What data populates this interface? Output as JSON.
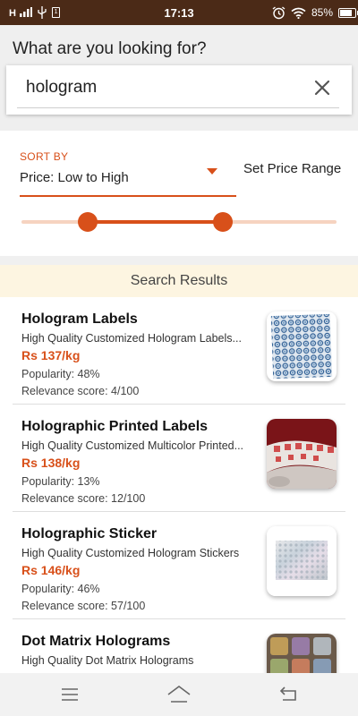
{
  "status_bar": {
    "signal_text": "H",
    "time": "17:13",
    "battery_percent": "85%",
    "battery_level": 0.85,
    "icons": [
      "signal-icon",
      "usb-icon",
      "sim-icon",
      "alarm-icon",
      "wifi-icon",
      "battery-icon",
      "charging-icon"
    ]
  },
  "search": {
    "heading": "What are you looking for?",
    "query": "hologram",
    "clear_icon": "close-icon"
  },
  "filters": {
    "sort_label": "SORT BY",
    "sort_value": "Price: Low to High",
    "price_range_label": "Set Price Range",
    "range_low": 0.21,
    "range_high": 0.64,
    "accent_color": "#d8501a"
  },
  "results": {
    "header": "Search Results",
    "items": [
      {
        "title": "Hologram Labels",
        "description": "High Quality Customized Hologram Labels...",
        "price": "Rs 137/kg",
        "popularity": "Popularity: 48%",
        "relevance": "Relevance score: 4/100"
      },
      {
        "title": "Holographic Printed Labels",
        "description": "High Quality Customized Multicolor Printed...",
        "price": "Rs 138/kg",
        "popularity": "Popularity: 13%",
        "relevance": "Relevance score: 12/100"
      },
      {
        "title": "Holographic Sticker",
        "description": "High Quality Customized Hologram Stickers",
        "price": "Rs 146/kg",
        "popularity": "Popularity: 46%",
        "relevance": "Relevance score: 57/100"
      },
      {
        "title": "Dot Matrix Holograms",
        "description": "High Quality Dot Matrix Holograms",
        "price": "",
        "popularity": "",
        "relevance": ""
      }
    ]
  },
  "nav": {
    "icons": [
      "menu-icon",
      "home-icon",
      "back-icon"
    ]
  }
}
